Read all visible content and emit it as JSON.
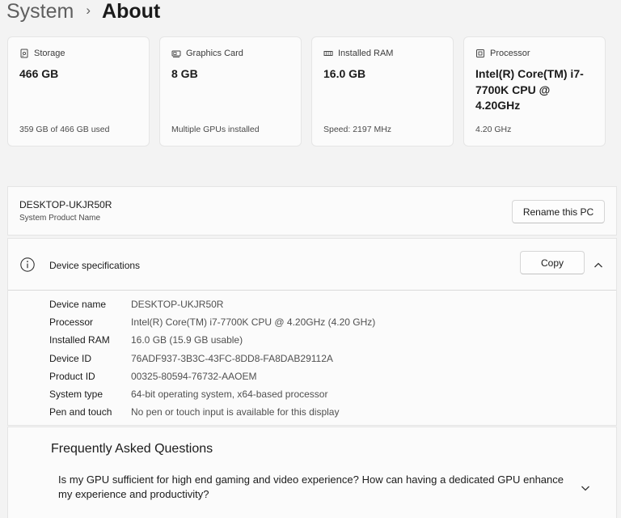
{
  "breadcrumb": {
    "parent": "System",
    "separator": "›",
    "current": "About"
  },
  "cards": [
    {
      "icon": "storage-icon",
      "title": "Storage",
      "value": "466 GB",
      "sub": "359 GB of 466 GB used"
    },
    {
      "icon": "graphics-card-icon",
      "title": "Graphics Card",
      "value": "8 GB",
      "sub": "Multiple GPUs installed"
    },
    {
      "icon": "ram-icon",
      "title": "Installed RAM",
      "value": "16.0 GB",
      "sub": "Speed: 2197 MHz"
    },
    {
      "icon": "processor-icon",
      "title": "Processor",
      "value": "Intel(R) Core(TM) i7-7700K CPU @ 4.20GHz",
      "sub": "4.20 GHz"
    }
  ],
  "pc": {
    "name": "DESKTOP-UKJR50R",
    "subtitle": "System Product Name",
    "rename_label": "Rename this PC"
  },
  "specs": {
    "title": "Device specifications",
    "copy_label": "Copy",
    "rows": [
      {
        "label": "Device name",
        "value": "DESKTOP-UKJR50R"
      },
      {
        "label": "Processor",
        "value": "Intel(R) Core(TM) i7-7700K CPU @ 4.20GHz (4.20 GHz)"
      },
      {
        "label": "Installed RAM",
        "value": "16.0 GB (15.9 GB usable)"
      },
      {
        "label": "Device ID",
        "value": "76ADF937-3B3C-43FC-8DD8-FA8DAB29112A"
      },
      {
        "label": "Product ID",
        "value": "00325-80594-76732-AAOEM"
      },
      {
        "label": "System type",
        "value": "64-bit operating system, x64-based processor"
      },
      {
        "label": "Pen and touch",
        "value": "No pen or touch input is available for this display"
      }
    ]
  },
  "faq": {
    "title": "Frequently Asked Questions",
    "question": "Is my GPU sufficient for high end gaming and video experience? How can having a dedicated GPU enhance my experience and productivity?"
  }
}
